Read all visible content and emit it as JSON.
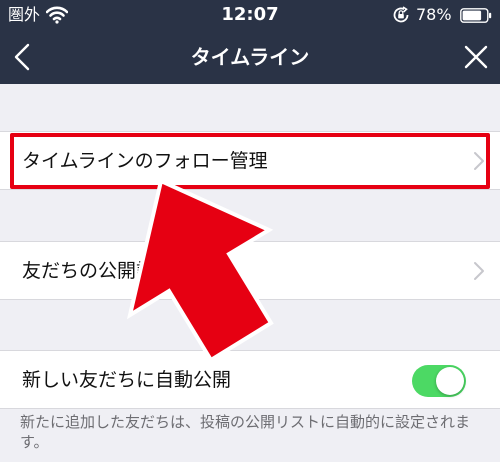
{
  "status_bar": {
    "carrier": "圏外",
    "time": "12:07",
    "battery": "78%"
  },
  "nav": {
    "title": "タイムライン"
  },
  "settings": {
    "follow_manage": "タイムラインのフォロー管理",
    "friend_visibility": "友だちの公開設定",
    "auto_publish": "新しい友だちに自動公開",
    "auto_publish_on": true,
    "footnote": "新たに追加した友だちは、投稿の公開リストに自動的に設定されます。"
  },
  "colors": {
    "navbar": "#2a3346",
    "highlight": "#e60012",
    "arrow": "#e60012",
    "toggle_on": "#4cd964"
  }
}
